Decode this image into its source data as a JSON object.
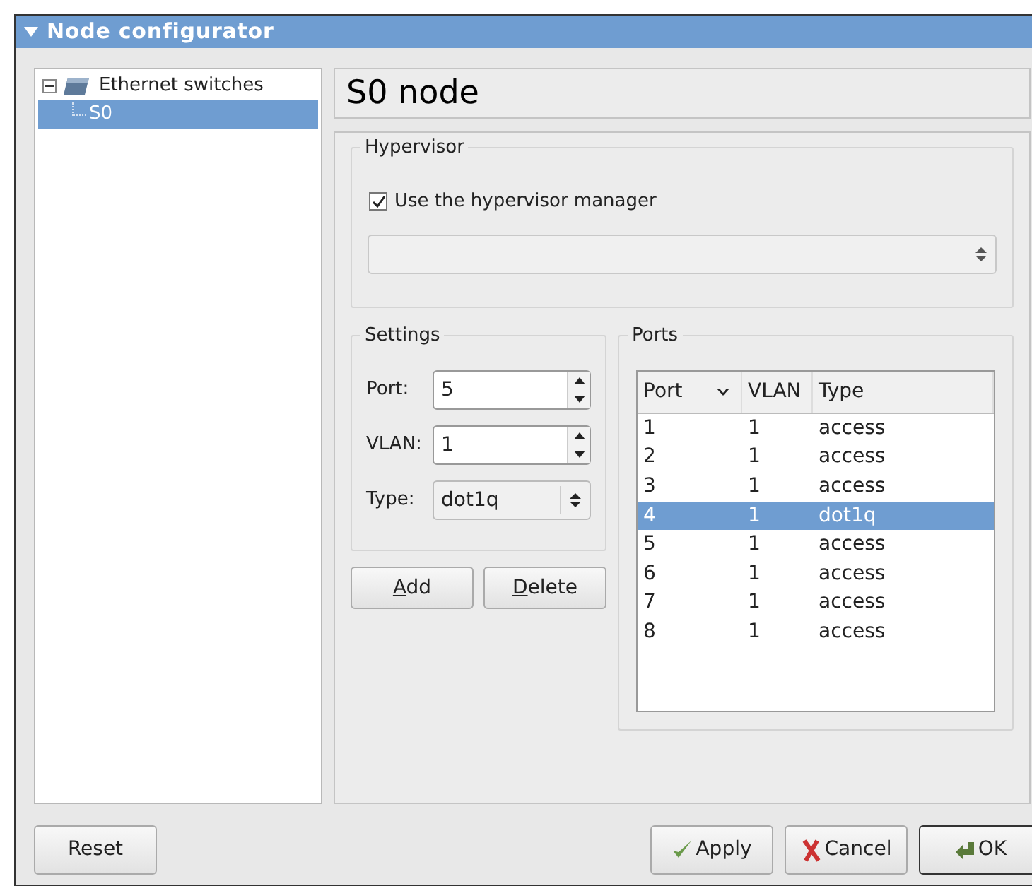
{
  "window": {
    "title": "Node configurator"
  },
  "tree": [
    {
      "label": "Ethernet switches",
      "expanded": true,
      "selected": false,
      "children": [
        {
          "label": "S0",
          "selected": true
        }
      ]
    }
  ],
  "node_title": "S0 node",
  "hypervisor": {
    "title": "Hypervisor",
    "use_manager": {
      "label": "Use the hypervisor manager",
      "checked": true
    }
  },
  "settings": {
    "title": "Settings",
    "port": {
      "label": "Port:",
      "value": "5"
    },
    "vlan": {
      "label": "VLAN:",
      "value": "1"
    },
    "type": {
      "label": "Type:",
      "value": "dot1q"
    }
  },
  "settings_buttons": [
    "Add",
    "Delete"
  ],
  "ports": {
    "title": "Ports",
    "columns": [
      "Port",
      "VLAN",
      "Type"
    ],
    "rows": [
      {
        "cells": [
          "1",
          "1",
          "access"
        ],
        "selected": false
      },
      {
        "cells": [
          "2",
          "1",
          "access"
        ],
        "selected": false
      },
      {
        "cells": [
          "3",
          "1",
          "access"
        ],
        "selected": false
      },
      {
        "cells": [
          "4",
          "1",
          "dot1q"
        ],
        "selected": true
      },
      {
        "cells": [
          "5",
          "1",
          "access"
        ],
        "selected": false
      },
      {
        "cells": [
          "6",
          "1",
          "access"
        ],
        "selected": false
      },
      {
        "cells": [
          "7",
          "1",
          "access"
        ],
        "selected": false
      },
      {
        "cells": [
          "8",
          "1",
          "access"
        ],
        "selected": false
      }
    ]
  },
  "reset_button": "Reset",
  "buttons": [
    {
      "kind": "apply",
      "label": "Apply"
    },
    {
      "kind": "cancel",
      "label": "Cancel"
    },
    {
      "kind": "ok",
      "label": "OK"
    }
  ]
}
